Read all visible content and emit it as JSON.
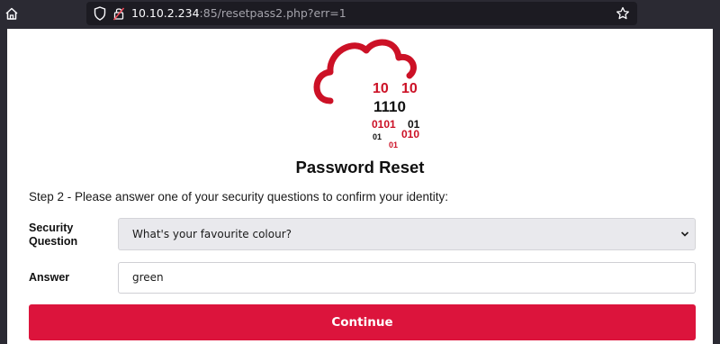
{
  "browser": {
    "url_host": "10.10.2.234",
    "url_rest": ":85/resetpass2.php?err=1",
    "icons": [
      "home-icon",
      "shield-icon",
      "insecure-lock-icon",
      "bookmark-star-icon"
    ]
  },
  "logo": {
    "binary_lines": [
      "10",
      "10",
      "1110",
      "0101",
      "01",
      "01",
      "010",
      "01"
    ],
    "colors": {
      "red": "#cc1126",
      "black": "#111111"
    }
  },
  "page": {
    "title": "Password Reset",
    "instructions": "Step 2 - Please answer one of your security questions to confirm your identity:"
  },
  "form": {
    "security_question_label_line1": "Security",
    "security_question_label_line2": "Question",
    "security_question_selected": "What's your favourite colour?",
    "answer_label": "Answer",
    "answer_value": "green",
    "submit_label": "Continue"
  },
  "colors": {
    "accent": "#dc143c",
    "browser_chrome": "#2b2a33",
    "url_field": "#1c1b22"
  }
}
